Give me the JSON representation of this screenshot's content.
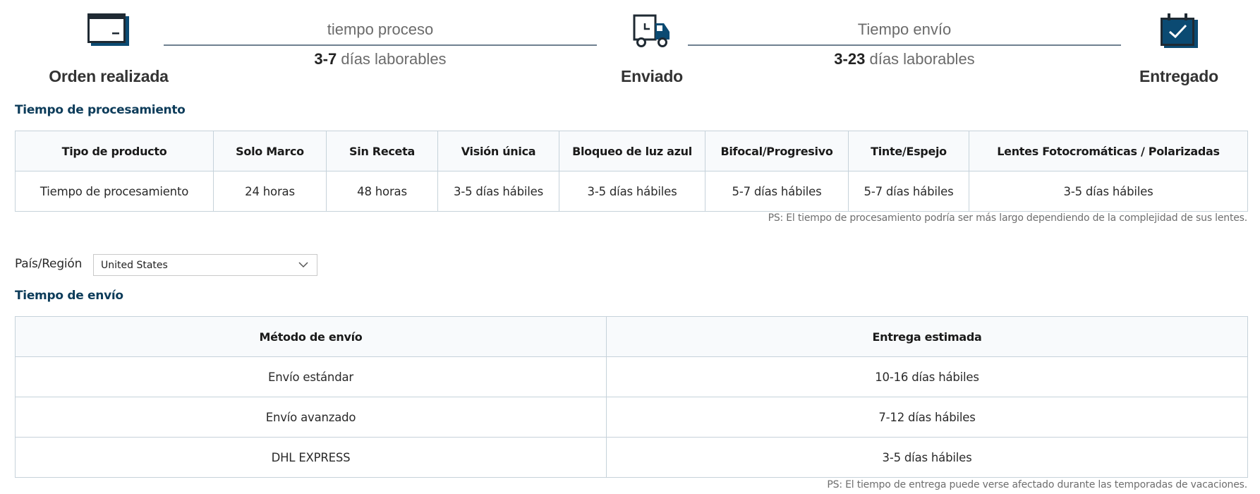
{
  "timeline": {
    "stages": [
      {
        "label": "Orden realizada",
        "icon": "credit-card-icon"
      },
      {
        "label": "Enviado",
        "icon": "delivery-truck-icon"
      },
      {
        "label": "Entregado",
        "icon": "calendar-check-icon"
      }
    ],
    "segments": [
      {
        "title": "tiempo proceso",
        "days": "3-7",
        "unit": "días laborables"
      },
      {
        "title": "Tiempo envío",
        "days": "3-23",
        "unit": "días laborables"
      }
    ]
  },
  "processing": {
    "title": "Tiempo de procesamiento",
    "headers": [
      "Tipo de producto",
      "Solo Marco",
      "Sin Receta",
      "Visión única",
      "Bloqueo de luz azul",
      "Bifocal/Progresivo",
      "Tinte/Espejo",
      "Lentes Fotocromáticas / Polarizadas"
    ],
    "row": [
      "Tiempo de procesamiento",
      "24 horas",
      "48 horas",
      "3-5 días hábiles",
      "3-5 días hábiles",
      "5-7 días hábiles",
      "5-7 días hábiles",
      "3-5 días hábiles"
    ],
    "note": "PS: El tiempo de procesamiento podría ser más largo dependiendo de la complejidad de sus lentes."
  },
  "country": {
    "label": "País/Región",
    "selected": "United States",
    "icon": "chevron-down-icon"
  },
  "shipping": {
    "title": "Tiempo de envío",
    "headers": [
      "Método de envío",
      "Entrega estimada"
    ],
    "rows": [
      [
        "Envío estándar",
        "10-16 días hábiles"
      ],
      [
        "Envío avanzado",
        "7-12 días hábiles"
      ],
      [
        "DHL EXPRESS",
        "3-5 días hábiles"
      ]
    ],
    "note": "PS: El tiempo de entrega puede verse afectado durante las temporadas de vacaciones."
  },
  "colors": {
    "brand_dark": "#0d3c5a",
    "icon_blue": "#0b4a72",
    "icon_dark": "#1f2a33",
    "border": "#c6d2da",
    "header_bg": "#f8fafc"
  }
}
